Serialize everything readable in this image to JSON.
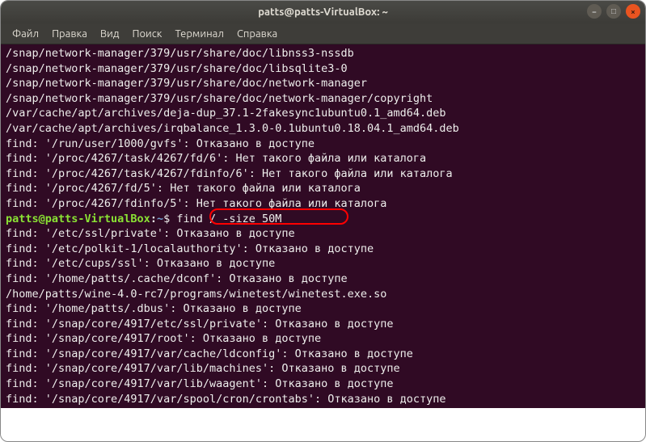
{
  "window": {
    "title": "patts@patts-VirtualBox: ~"
  },
  "menu": {
    "file": "Файл",
    "edit": "Правка",
    "view": "Вид",
    "search": "Поиск",
    "terminal": "Терминал",
    "help": "Справка"
  },
  "controls": {
    "min": "−",
    "max": "□",
    "close": "×"
  },
  "prompt": {
    "user_host": "patts@patts-VirtualBox",
    "colon": ":",
    "path": "~",
    "dollar": "$",
    "command": " find / -size 50M"
  },
  "lines": {
    "l0": "/snap/network-manager/379/usr/share/doc/libnss3-nssdb",
    "l1": "/snap/network-manager/379/usr/share/doc/libsqlite3-0",
    "l2": "/snap/network-manager/379/usr/share/doc/network-manager",
    "l3": "/snap/network-manager/379/usr/share/doc/network-manager/copyright",
    "l4": "/var/cache/apt/archives/deja-dup_37.1-2fakesync1ubuntu0.1_amd64.deb",
    "l5": "/var/cache/apt/archives/irqbalance_1.3.0-0.1ubuntu0.18.04.1_amd64.deb",
    "l6": "find: '/run/user/1000/gvfs': Отказано в доступе",
    "l7": "find: '/proc/4267/task/4267/fd/6': Нет такого файла или каталога",
    "l8": "find: '/proc/4267/task/4267/fdinfo/6': Нет такого файла или каталога",
    "l9": "find: '/proc/4267/fd/5': Нет такого файла или каталога",
    "l10": "find: '/proc/4267/fdinfo/5': Нет такого файла или каталога",
    "l11": "find: '/etc/ssl/private': Отказано в доступе",
    "l12": "find: '/etc/polkit-1/localauthority': Отказано в доступе",
    "l13": "find: '/etc/cups/ssl': Отказано в доступе",
    "l14": "find: '/home/patts/.cache/dconf': Отказано в доступе",
    "l15": "/home/patts/wine-4.0-rc7/programs/winetest/winetest.exe.so",
    "l16": "find: '/home/patts/.dbus': Отказано в доступе",
    "l17": "find: '/snap/core/4917/etc/ssl/private': Отказано в доступе",
    "l18": "find: '/snap/core/4917/root': Отказано в доступе",
    "l19": "find: '/snap/core/4917/var/cache/ldconfig': Отказано в доступе",
    "l20": "find: '/snap/core/4917/var/lib/machines': Отказано в доступе",
    "l21": "find: '/snap/core/4917/var/lib/waagent': Отказано в доступе",
    "l22": "find: '/snap/core/4917/var/spool/cron/crontabs': Отказано в доступе"
  }
}
